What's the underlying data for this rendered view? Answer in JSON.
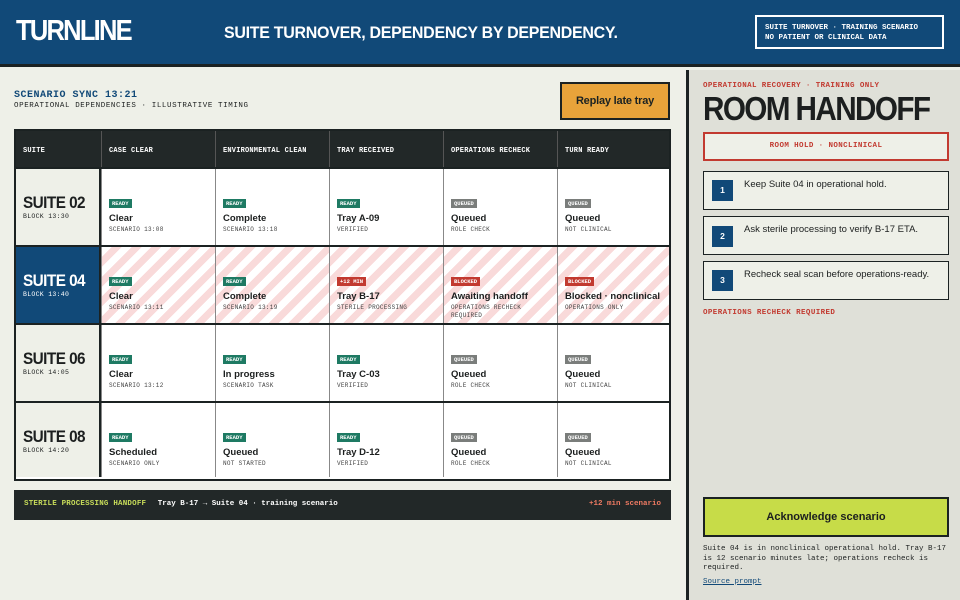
{
  "header": {
    "logo": "TURNLINE",
    "headline": "SUITE TURNOVER, DEPENDENCY BY DEPENDENCY.",
    "scenario_line1": "SUITE TURNOVER · TRAINING SCENARIO",
    "scenario_line2": "NO PATIENT OR CLINICAL DATA"
  },
  "main": {
    "sync": "SCENARIO SYNC 13:21",
    "sync_sub": "OPERATIONAL DEPENDENCIES · ILLUSTRATIVE TIMING",
    "replay_label": "Replay late tray"
  },
  "grid": {
    "columns": [
      "SUITE",
      "CASE CLEAR",
      "ENVIRONMENTAL CLEAN",
      "TRAY RECEIVED",
      "OPERATIONS RECHECK",
      "TURN READY"
    ],
    "rows": [
      {
        "suite": "SUITE 02",
        "block": "BLOCK 13:30",
        "cells": [
          {
            "badge": "READY",
            "kind": "ready",
            "status": "Clear",
            "detail": "SCENARIO 13:08"
          },
          {
            "badge": "READY",
            "kind": "ready",
            "status": "Complete",
            "detail": "SCENARIO 13:18"
          },
          {
            "badge": "READY",
            "kind": "ready",
            "status": "Tray A-09",
            "detail": "VERIFIED"
          },
          {
            "badge": "QUEUED",
            "kind": "queued",
            "status": "Queued",
            "detail": "ROLE CHECK"
          },
          {
            "badge": "QUEUED",
            "kind": "queued",
            "status": "Queued",
            "detail": "NOT CLINICAL"
          }
        ]
      },
      {
        "suite": "SUITE 04",
        "block": "BLOCK 13:40",
        "cells": [
          {
            "badge": "READY",
            "kind": "ready",
            "status": "Clear",
            "detail": "SCENARIO 13:11"
          },
          {
            "badge": "READY",
            "kind": "ready",
            "status": "Complete",
            "detail": "SCENARIO 13:19"
          },
          {
            "badge": "+12 MIN",
            "kind": "late",
            "status": "Tray B-17",
            "detail": "STERILE PROCESSING"
          },
          {
            "badge": "BLOCKED",
            "kind": "blocked",
            "status": "Awaiting handoff",
            "detail": "OPERATIONS RECHECK",
            "detail2": "REQUIRED"
          },
          {
            "badge": "BLOCKED",
            "kind": "blocked",
            "status": "Blocked · nonclinical",
            "detail": "OPERATIONS ONLY"
          }
        ]
      },
      {
        "suite": "SUITE 06",
        "block": "BLOCK 14:05",
        "cells": [
          {
            "badge": "READY",
            "kind": "ready",
            "status": "Clear",
            "detail": "SCENARIO 13:12"
          },
          {
            "badge": "READY",
            "kind": "ready",
            "status": "In progress",
            "detail": "SCENARIO TASK"
          },
          {
            "badge": "READY",
            "kind": "ready",
            "status": "Tray C-03",
            "detail": "VERIFIED"
          },
          {
            "badge": "QUEUED",
            "kind": "queued",
            "status": "Queued",
            "detail": "ROLE CHECK"
          },
          {
            "badge": "QUEUED",
            "kind": "queued",
            "status": "Queued",
            "detail": "NOT CLINICAL"
          }
        ]
      },
      {
        "suite": "SUITE 08",
        "block": "BLOCK 14:20",
        "cells": [
          {
            "badge": "READY",
            "kind": "ready",
            "status": "Scheduled",
            "detail": "SCENARIO ONLY"
          },
          {
            "badge": "READY",
            "kind": "ready",
            "status": "Queued",
            "detail": "NOT STARTED"
          },
          {
            "badge": "READY",
            "kind": "ready",
            "status": "Tray D-12",
            "detail": "VERIFIED"
          },
          {
            "badge": "QUEUED",
            "kind": "queued",
            "status": "Queued",
            "detail": "ROLE CHECK"
          },
          {
            "badge": "QUEUED",
            "kind": "queued",
            "status": "Queued",
            "detail": "NOT CLINICAL"
          }
        ]
      }
    ]
  },
  "bottom_bar": {
    "label": "STERILE PROCESSING HANDOFF",
    "text": "Tray B-17 → Suite 04 · training scenario",
    "late": "+12 min scenario"
  },
  "side": {
    "kicker": "OPERATIONAL RECOVERY · TRAINING ONLY",
    "title": "ROOM HANDOFF",
    "hold": "ROOM HOLD · NONCLINICAL",
    "steps": [
      {
        "num": "1",
        "text": "Keep Suite 04 in operational hold."
      },
      {
        "num": "2",
        "text": "Ask sterile processing to verify B-17 ETA."
      },
      {
        "num": "3",
        "text": "Recheck seal scan before operations-ready."
      }
    ],
    "recheck": "OPERATIONS RECHECK REQUIRED",
    "ack_label": "Acknowledge scenario",
    "summary": "Suite 04 is in nonclinical operational hold. Tray B-17 is 12 scenario minutes late; operations recheck is required.",
    "source": "Source prompt"
  },
  "colors": {
    "navy": "#114978",
    "ready": "#1e7a63",
    "queued": "#7a7d7b",
    "alert": "#c23a30",
    "amber": "#e8a33a",
    "lime": "#c7dc48"
  }
}
